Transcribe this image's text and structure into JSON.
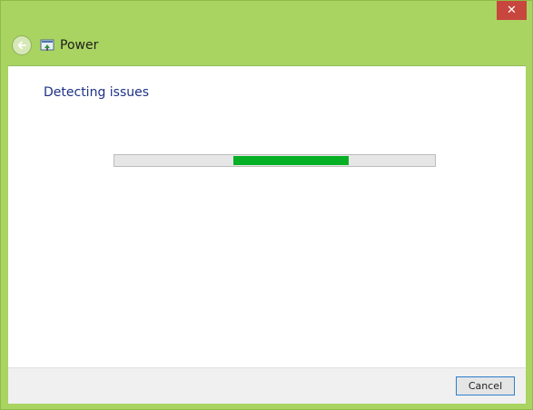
{
  "window": {
    "title": "Power",
    "close_glyph": "✕"
  },
  "icons": {
    "back": "back-arrow-icon",
    "app": "troubleshooter-icon",
    "close": "close-icon"
  },
  "main": {
    "heading": "Detecting issues",
    "progress": {
      "state": "indeterminate",
      "color": "#06b025"
    }
  },
  "footer": {
    "cancel_label": "Cancel"
  },
  "colors": {
    "frame": "#a9d461",
    "close_button": "#c7463d",
    "heading_text": "#1e3287",
    "progress_fill": "#06b025"
  }
}
